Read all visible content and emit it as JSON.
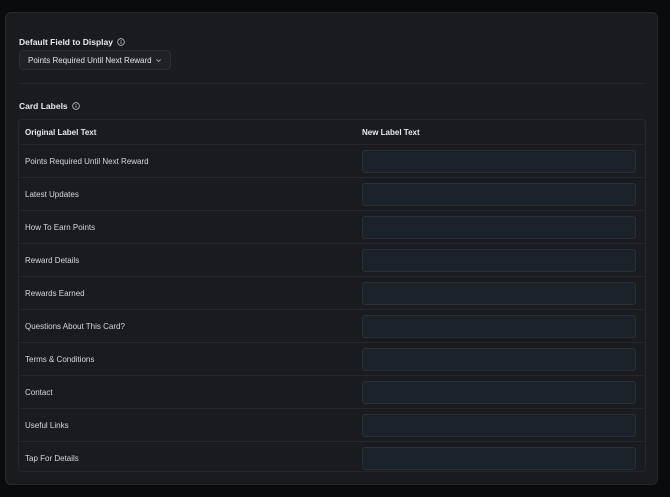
{
  "default_field": {
    "label": "Default Field to Display",
    "selected_value": "Points Required Until Next Reward"
  },
  "card_labels": {
    "label": "Card Labels",
    "columns": {
      "original": "Original Label Text",
      "new": "New Label Text"
    },
    "rows": [
      {
        "original": "Points Required Until Next Reward",
        "new_value": ""
      },
      {
        "original": "Latest Updates",
        "new_value": ""
      },
      {
        "original": "How To Earn Points",
        "new_value": ""
      },
      {
        "original": "Reward Details",
        "new_value": ""
      },
      {
        "original": "Rewards Earned",
        "new_value": ""
      },
      {
        "original": "Questions About This Card?",
        "new_value": ""
      },
      {
        "original": "Terms & Conditions",
        "new_value": ""
      },
      {
        "original": "Contact",
        "new_value": ""
      },
      {
        "original": "Useful Links",
        "new_value": ""
      },
      {
        "original": "Tap For Details",
        "new_value": ""
      }
    ]
  },
  "icons": {
    "info": "info-icon",
    "chevron": "chevron-down-icon"
  },
  "colors": {
    "page_bg": "#0a0b0d",
    "panel_bg": "#1a1b1f",
    "input_bg": "#1c2229",
    "text": "#e6e8eb",
    "border": "#25272c"
  }
}
